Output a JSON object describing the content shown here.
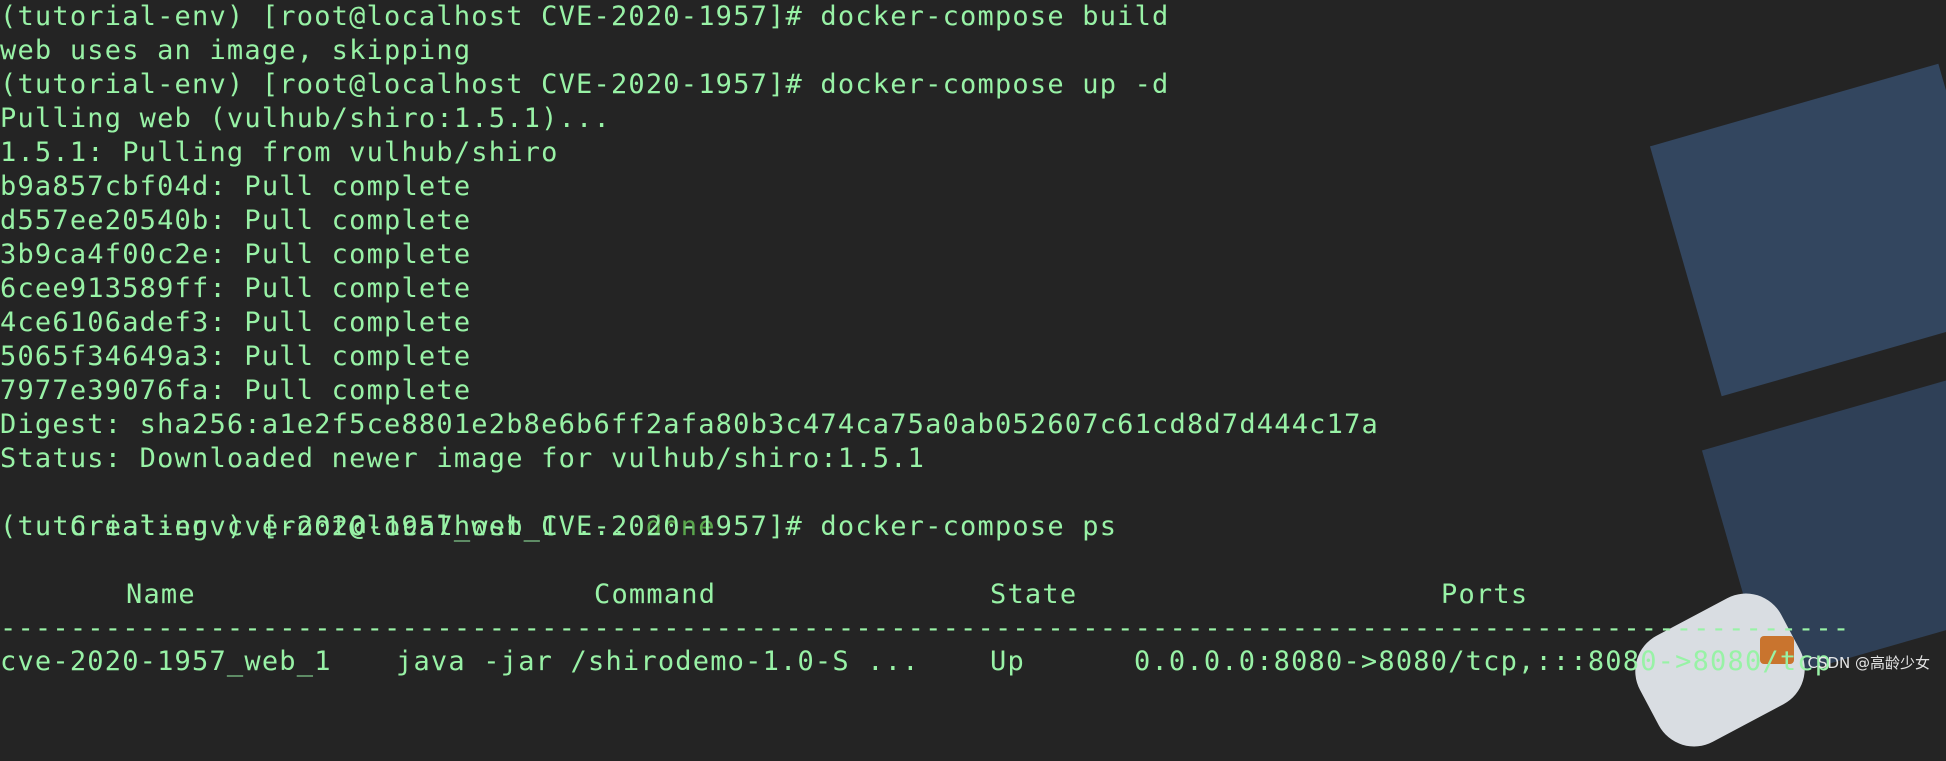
{
  "colors": {
    "background": "#242424",
    "terminal_text": "#98f2a6",
    "done_text": "#5aa74d",
    "watermark_text": "#f4f4f4"
  },
  "terminal": {
    "lines": [
      "(tutorial-env) [root@localhost CVE-2020-1957]# docker-compose build",
      "web uses an image, skipping",
      "(tutorial-env) [root@localhost CVE-2020-1957]# docker-compose up -d",
      "Pulling web (vulhub/shiro:1.5.1)...",
      "1.5.1: Pulling from vulhub/shiro",
      "b9a857cbf04d: Pull complete",
      "d557ee20540b: Pull complete",
      "3b9ca4f00c2e: Pull complete",
      "6cee913589ff: Pull complete",
      "4ce6106adef3: Pull complete",
      "5065f34649a3: Pull complete",
      "7977e39076fa: Pull complete",
      "Digest: sha256:a1e2f5ce8801e2b8e6b6ff2afa80b3c474ca75a0ab052607c61cd8d7d444c17a",
      "Status: Downloaded newer image for vulhub/shiro:1.5.1"
    ],
    "creating_prefix": "Creating cve-2020-1957_web_1 ... ",
    "creating_status": "done",
    "ps_prompt": "(tutorial-env) [root@localhost CVE-2020-1957]# docker-compose ps",
    "table": {
      "headers": {
        "name": "Name",
        "command": "Command",
        "state": "State",
        "ports": "Ports"
      },
      "divider": "----------------------------------------------------------------------------------------------------------------",
      "row": {
        "name": "cve-2020-1957_web_1",
        "command": "java -jar /shirodemo-1.0-S ...",
        "state": "Up",
        "ports": "0.0.0.0:8080->8080/tcp,:::8080->8080/tcp"
      }
    }
  },
  "watermark": "CSDN @高龄少女"
}
